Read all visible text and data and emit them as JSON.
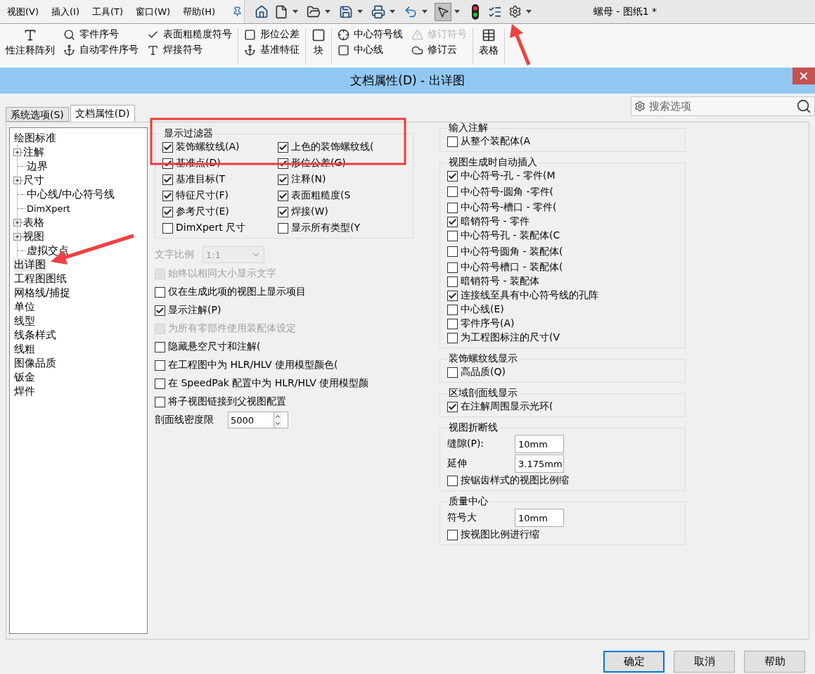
{
  "menu": [
    "视图(V)",
    "插入(I)",
    "工具(T)",
    "窗口(W)",
    "帮助(H)"
  ],
  "document_title": "螺母 - 图纸1 *",
  "ribbon": {
    "groups": [
      {
        "columns": [
          [
            {
              "label": "性注释阵列",
              "kind": "large",
              "disabled": false
            }
          ],
          [
            {
              "label": "零件序号",
              "kind": "small",
              "disabled": false
            },
            {
              "label": "自动零件序号",
              "kind": "small",
              "disabled": false
            }
          ],
          [
            {
              "label": "表面粗糙度符号",
              "kind": "small",
              "disabled": false
            },
            {
              "label": "焊接符号",
              "kind": "small",
              "disabled": false
            }
          ]
        ]
      },
      {
        "columns": [
          [
            {
              "label": "形位公差",
              "kind": "small",
              "disabled": false
            },
            {
              "label": "基准特征",
              "kind": "small",
              "disabled": false
            }
          ]
        ]
      },
      {
        "columns": [
          [
            {
              "label": "块",
              "kind": "large",
              "disabled": false
            }
          ]
        ]
      },
      {
        "columns": [
          [
            {
              "label": "中心符号线",
              "kind": "small",
              "disabled": false
            },
            {
              "label": "中心线",
              "kind": "small",
              "disabled": false
            }
          ],
          [
            {
              "label": "修订符号",
              "kind": "small",
              "disabled": true
            },
            {
              "label": "修订云",
              "kind": "small",
              "disabled": false
            }
          ]
        ]
      },
      {
        "columns": [
          [
            {
              "label": "表格",
              "kind": "large",
              "disabled": false
            }
          ]
        ]
      }
    ]
  },
  "dialog": {
    "title": "文档属性(D) - 出详图",
    "tabs": [
      {
        "label": "系统选项(S)",
        "selected": false
      },
      {
        "label": "文档属性(D)",
        "selected": true
      }
    ],
    "search": {
      "placeholder": "搜索选项"
    },
    "tree": [
      {
        "label": "绘图标准",
        "selected": false,
        "children": [
          {
            "label": "注解",
            "selected": false,
            "collapsed": true
          },
          {
            "label": "边界",
            "selected": false,
            "collapsed": false
          },
          {
            "label": "尺寸",
            "selected": false,
            "collapsed": true
          },
          {
            "label": "中心线/中心符号线",
            "selected": false,
            "collapsed": false
          },
          {
            "label": "DimXpert",
            "selected": false,
            "collapsed": false
          },
          {
            "label": "表格",
            "selected": false,
            "collapsed": true
          },
          {
            "label": "视图",
            "selected": false,
            "collapsed": true
          },
          {
            "label": "虚拟交点",
            "selected": false,
            "collapsed": false
          }
        ]
      },
      {
        "label": "出详图",
        "selected": true
      },
      {
        "label": "工程图图纸",
        "selected": false
      },
      {
        "label": "网格线/捕捉",
        "selected": false
      },
      {
        "label": "单位",
        "selected": false
      },
      {
        "label": "线型",
        "selected": false
      },
      {
        "label": "线条样式",
        "selected": false
      },
      {
        "label": "线粗",
        "selected": false
      },
      {
        "label": "图像品质",
        "selected": false
      },
      {
        "label": "钣金",
        "selected": false
      },
      {
        "label": "焊件",
        "selected": false
      }
    ],
    "display_filter": {
      "title": "显示过滤器",
      "options": [
        {
          "label": "装饰螺纹线(A)",
          "checked": true
        },
        {
          "label": "上色的装饰螺纹线(",
          "checked": true
        },
        {
          "label": "基准点(D)",
          "checked": true
        },
        {
          "label": "形位公差(G)",
          "checked": true
        },
        {
          "label": "基准目标(T",
          "checked": true
        },
        {
          "label": "注释(N)",
          "checked": true
        },
        {
          "label": "特征尺寸(F)",
          "checked": true
        },
        {
          "label": "表面粗糙度(S",
          "checked": true
        },
        {
          "label": "参考尺寸(E)",
          "checked": true
        },
        {
          "label": "焊接(W)",
          "checked": true
        },
        {
          "label": "DimXpert 尺寸",
          "checked": false
        },
        {
          "label": "显示所有类型(Y",
          "checked": false
        }
      ]
    },
    "text_scale": {
      "label": "文字比例",
      "value": "1:1",
      "disabled": true
    },
    "options": [
      {
        "label": "始终以相同大小显示文字",
        "checked": false,
        "disabled": true
      },
      {
        "label": "仅在生成此项的视图上显示项目",
        "checked": false,
        "disabled": false
      },
      {
        "label": "显示注解(P)",
        "checked": true,
        "disabled": false
      },
      {
        "label": "为所有零部件使用装配体设定",
        "checked": false,
        "disabled": true
      },
      {
        "label": "隐藏悬空尺寸和注解(",
        "checked": false,
        "disabled": false
      },
      {
        "label": "在工程图中为 HLR/HLV 使用模型颜色(",
        "checked": false,
        "disabled": false
      },
      {
        "label": "在 SpeedPak 配置中为 HLR/HLV 使用模型颜",
        "checked": false,
        "disabled": false
      },
      {
        "label": "将子视图链接到父视图配置",
        "checked": false,
        "disabled": false
      }
    ],
    "hatch_density": {
      "label": "剖面线密度限",
      "value": "5000"
    },
    "groups": [
      {
        "title": "输入注解",
        "items": [
          {
            "kind": "checkbox",
            "label": "从整个装配体(A",
            "checked": false
          }
        ]
      },
      {
        "title": "视图生成时自动插入",
        "items": [
          {
            "kind": "checkbox",
            "label": "中心符号-孔 - 零件(M",
            "checked": true
          },
          {
            "kind": "checkbox",
            "label": "中心符号-圆角  -零件(",
            "checked": false
          },
          {
            "kind": "checkbox",
            "label": "中心符号-槽口 - 零件(",
            "checked": false
          },
          {
            "kind": "checkbox",
            "label": "暗销符号 - 零件",
            "checked": true
          },
          {
            "kind": "checkbox",
            "label": "中心符号孔 - 装配体(C",
            "checked": false
          },
          {
            "kind": "checkbox",
            "label": "中心符号圆角 - 装配体(",
            "checked": false
          },
          {
            "kind": "checkbox",
            "label": "中心符号槽口 - 装配体(",
            "checked": false
          },
          {
            "kind": "checkbox",
            "label": "暗销符号 - 装配体",
            "checked": false
          },
          {
            "kind": "checkbox",
            "label": "连接线至具有中心符号线的孔阵",
            "checked": true
          },
          {
            "kind": "checkbox",
            "label": "中心线(E)",
            "checked": false
          },
          {
            "kind": "checkbox",
            "label": "零件序号(A)",
            "checked": false
          },
          {
            "kind": "checkbox",
            "label": "为工程图标注的尺寸(V",
            "checked": false
          }
        ]
      },
      {
        "title": "装饰螺纹线显示",
        "items": [
          {
            "kind": "checkbox",
            "label": "高品质(Q)",
            "checked": false
          }
        ]
      },
      {
        "title": "区域剖面线显示",
        "items": [
          {
            "kind": "checkbox",
            "label": "在注解周围显示光环(",
            "checked": true
          }
        ]
      },
      {
        "title": "视图折断线",
        "items": [
          {
            "kind": "field",
            "label": "缝隙(P):",
            "value": "10mm"
          },
          {
            "kind": "field",
            "label": "延伸",
            "value": "3.175mm"
          },
          {
            "kind": "checkbox",
            "label": "按锯齿样式的视图比例缩",
            "checked": false
          }
        ]
      },
      {
        "title": "质量中心",
        "items": [
          {
            "kind": "field",
            "label": "符号大",
            "value": "10mm"
          },
          {
            "kind": "checkbox",
            "label": "按视图比例进行缩",
            "checked": false
          }
        ]
      }
    ],
    "buttons": [
      {
        "label": "确定",
        "focused": true
      },
      {
        "label": "取消",
        "focused": false
      },
      {
        "label": "帮助",
        "focused": false
      }
    ]
  }
}
